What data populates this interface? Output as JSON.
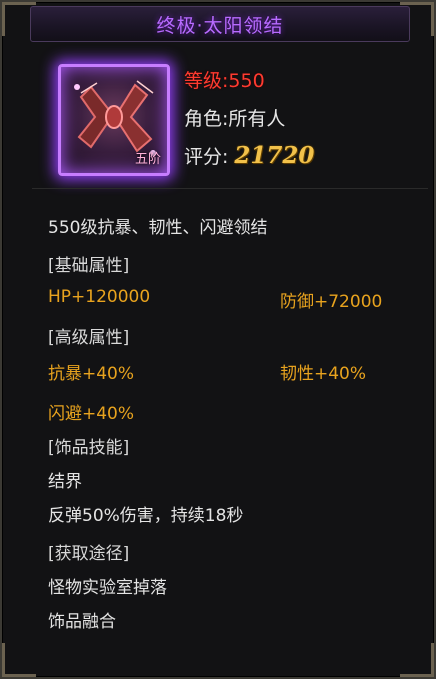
{
  "item": {
    "title": "终极·太阳领结",
    "level_label": "等级:550",
    "role_label": "角色:所有人",
    "score_label": "评分:",
    "score_value": "21720",
    "icon_badge": "五阶"
  },
  "description": "550级抗暴、韧性、闪避领结",
  "sections": {
    "basic": "[基础属性]",
    "advanced": "[高级属性]",
    "skill": "[饰品技能]",
    "source": "[获取途径]"
  },
  "basic_stats": {
    "hp": "HP+120000",
    "defense": "防御+72000"
  },
  "advanced_stats": {
    "anti_crit": "抗暴+40%",
    "toughness": "韧性+40%",
    "dodge": "闪避+40%"
  },
  "skill": {
    "name": "结界",
    "effect": "反弹50%伤害，持续18秒"
  },
  "source": {
    "line1": "怪物实验室掉落",
    "line2": "饰品融合"
  },
  "colors": {
    "title": "#b86bff",
    "level": "#ff3b30",
    "score": "#f2c14a",
    "stat": "#e8a31e",
    "text": "#e4e4e4"
  }
}
